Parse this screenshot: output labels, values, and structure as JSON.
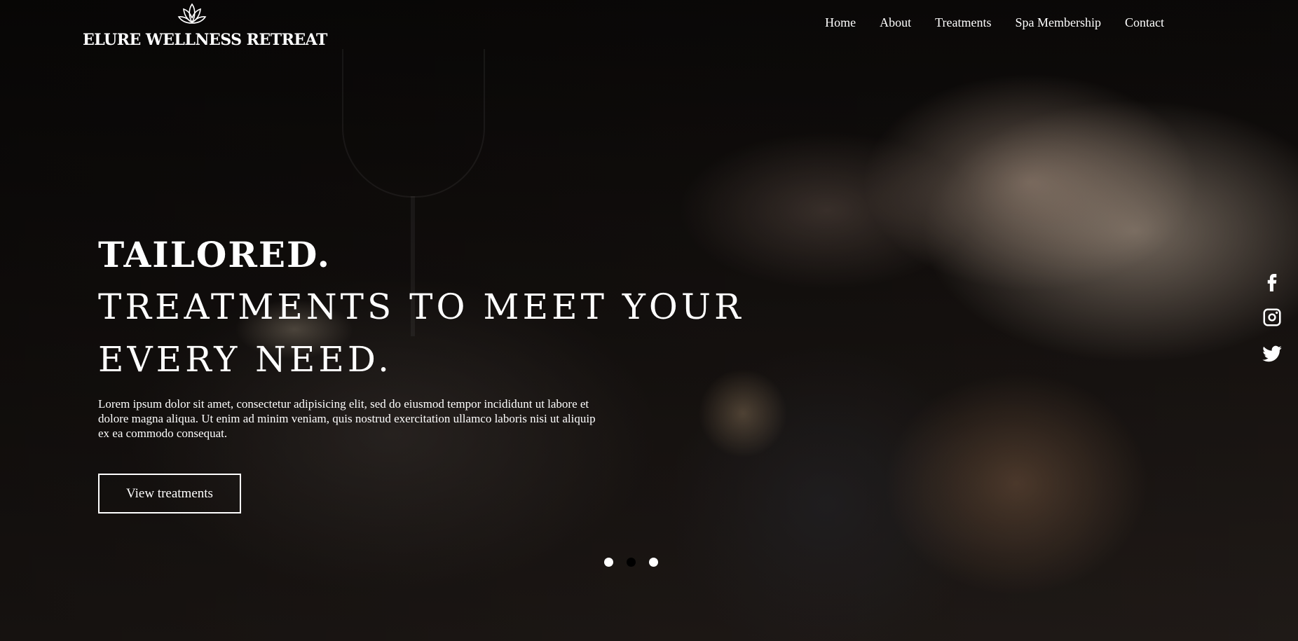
{
  "brand": {
    "name": "ELURE WELLNESS RETREAT",
    "logo_icon": "lotus-icon"
  },
  "nav": {
    "items": [
      {
        "label": "Home"
      },
      {
        "label": "About"
      },
      {
        "label": "Treatments"
      },
      {
        "label": "Spa Membership"
      },
      {
        "label": "Contact"
      }
    ]
  },
  "hero": {
    "headline_line1": "TAILORED.",
    "headline_line2": "TREATMENTS TO MEET YOUR",
    "headline_line3": "EVERY NEED.",
    "lead": "Lorem ipsum dolor sit amet, consectetur adipisicing elit, sed do eiusmod tempor incididunt ut labore et dolore magna aliqua. Ut enim ad minim veniam, quis nostrud exercitation ullamco laboris nisi ut aliquip ex ea commodo consequat.",
    "cta_label": "View treatments"
  },
  "carousel": {
    "slide_count": 3,
    "active_index": 1
  },
  "social": {
    "icons": [
      "facebook-icon",
      "instagram-icon",
      "twitter-icon"
    ]
  },
  "colors": {
    "text": "#ffffff",
    "active_dot": "#000000"
  }
}
